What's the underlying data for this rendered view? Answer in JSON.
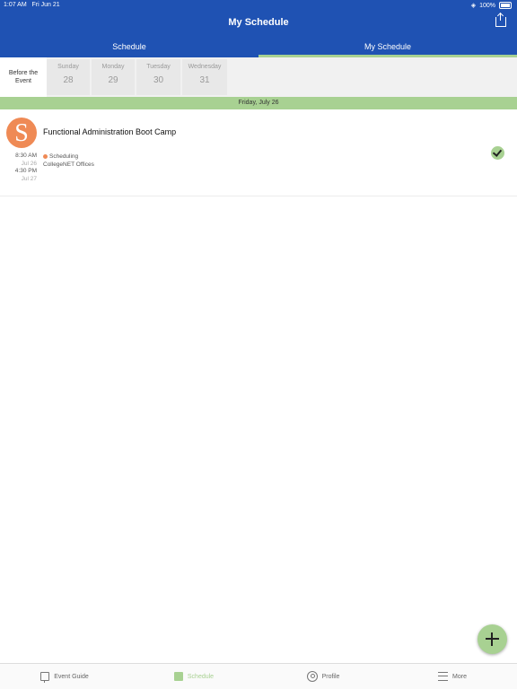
{
  "status_bar": {
    "time": "1:07 AM",
    "date": "Fri Jun 21",
    "battery": "100%"
  },
  "header": {
    "title": "My Schedule"
  },
  "tabs": [
    {
      "label": "Schedule",
      "active": false
    },
    {
      "label": "My Schedule",
      "active": true
    }
  ],
  "days": {
    "before": "Before the Event",
    "items": [
      {
        "name": "Sunday",
        "num": "28"
      },
      {
        "name": "Monday",
        "num": "29"
      },
      {
        "name": "Tuesday",
        "num": "30"
      },
      {
        "name": "Wednesday",
        "num": "31"
      }
    ]
  },
  "date_band": "Friday, July 26",
  "event": {
    "title": "Functional Administration Boot Camp",
    "start_time": "8:30 AM",
    "start_date": "Jul 26",
    "end_time": "4:30 PM",
    "end_date": "Jul 27",
    "track": "Scheduling",
    "location": "CollegeNET Offices",
    "track_color": "#ef8a55",
    "added": true
  },
  "bottom_nav": [
    {
      "label": "Event Guide",
      "icon": "event-guide-icon",
      "active": false
    },
    {
      "label": "Schedule",
      "icon": "calendar-icon",
      "active": true
    },
    {
      "label": "Profile",
      "icon": "profile-icon",
      "active": false
    },
    {
      "label": "More",
      "icon": "menu-icon",
      "active": false
    }
  ],
  "colors": {
    "header": "#1f52b3",
    "accent": "#a8d192",
    "track": "#ef8a55"
  }
}
